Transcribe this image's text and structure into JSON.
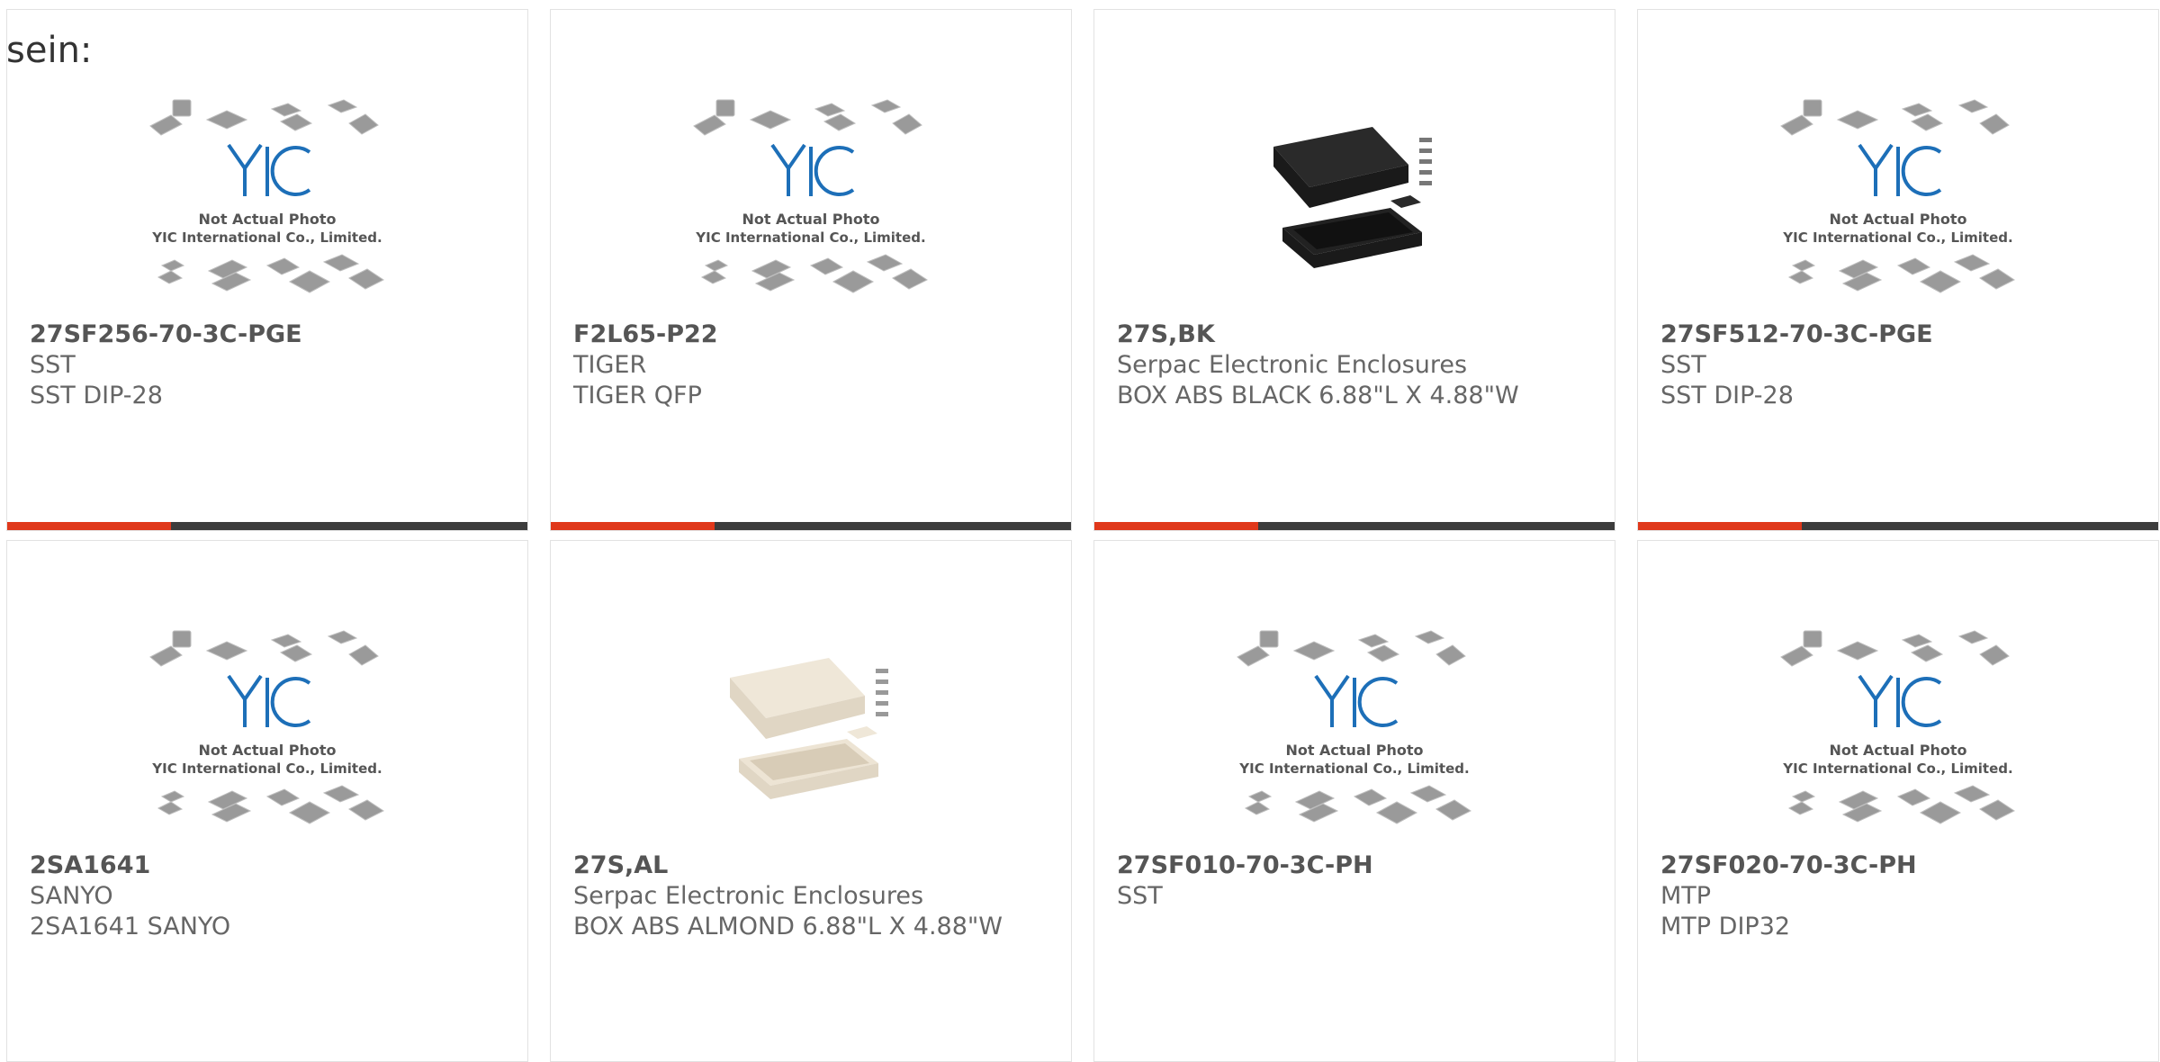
{
  "heading_fragment": "sein:",
  "accent_color": "#e0381b",
  "bar_color": "#3c3c3c",
  "placeholder_image": {
    "logo_text": "YIC",
    "caption_line1": "Not Actual Photo",
    "caption_line2": "YIC International Co., Limited."
  },
  "products": [
    {
      "part_number": "27SF256-70-3C-PGE",
      "manufacturer": "SST",
      "description": "SST DIP-28",
      "image": "placeholder"
    },
    {
      "part_number": "F2L65-P22",
      "manufacturer": "TIGER",
      "description": "TIGER QFP",
      "image": "placeholder"
    },
    {
      "part_number": "27S,BK",
      "manufacturer": "Serpac Electronic Enclosures",
      "description": "BOX ABS BLACK 6.88\"L X 4.88\"W",
      "image": "enclosure-black"
    },
    {
      "part_number": "27SF512-70-3C-PGE",
      "manufacturer": "SST",
      "description": "SST DIP-28",
      "image": "placeholder"
    },
    {
      "part_number": "2SA1641",
      "manufacturer": "SANYO",
      "description": "2SA1641 SANYO",
      "image": "placeholder"
    },
    {
      "part_number": "27S,AL",
      "manufacturer": "Serpac Electronic Enclosures",
      "description": "BOX ABS ALMOND 6.88\"L X 4.88\"W",
      "image": "enclosure-almond"
    },
    {
      "part_number": "27SF010-70-3C-PH",
      "manufacturer": "SST",
      "description": "",
      "image": "placeholder"
    },
    {
      "part_number": "27SF020-70-3C-PH",
      "manufacturer": "MTP",
      "description": "MTP DIP32",
      "image": "placeholder"
    }
  ]
}
